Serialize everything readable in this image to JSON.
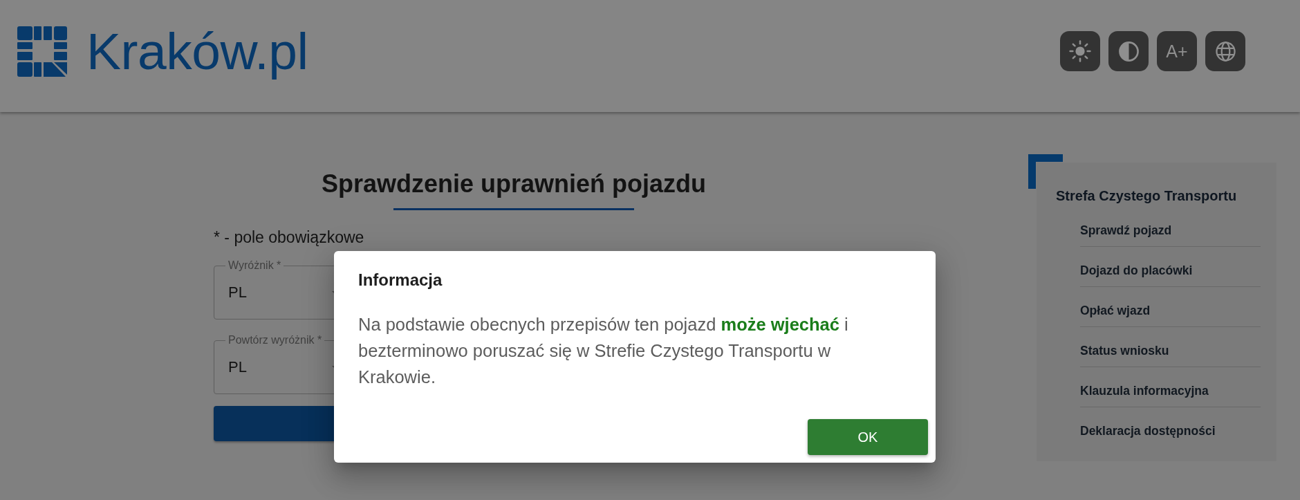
{
  "header": {
    "logo_text": "Kraków.pl",
    "buttons": [
      {
        "kind": "brightness"
      },
      {
        "kind": "contrast"
      },
      {
        "kind": "font_size",
        "label": "A+"
      },
      {
        "kind": "language"
      }
    ]
  },
  "form": {
    "title": "Sprawdzenie uprawnień pojazdu",
    "required_note": "* - pole obowiązkowe",
    "fields": [
      {
        "label": "Wyróżnik *",
        "value": "PL"
      },
      {
        "label": "Powtórz wyróżnik *",
        "value": "PL"
      }
    ]
  },
  "sidebar": {
    "title": "Strefa Czystego Transportu",
    "items": [
      "Sprawdź pojazd",
      "Dojazd do placówki",
      "Opłać wjazd",
      "Status wniosku",
      "Klauzula informacyjna",
      "Deklaracja dostępności"
    ]
  },
  "dialog": {
    "title": "Informacja",
    "message": "Na podstawie obecnych przepisów ten pojazd **może wjechać** i bezterminowo poruszać się w Strefie Czystego Transportu w Krakowie.",
    "buttons": [
      "OK"
    ]
  }
}
